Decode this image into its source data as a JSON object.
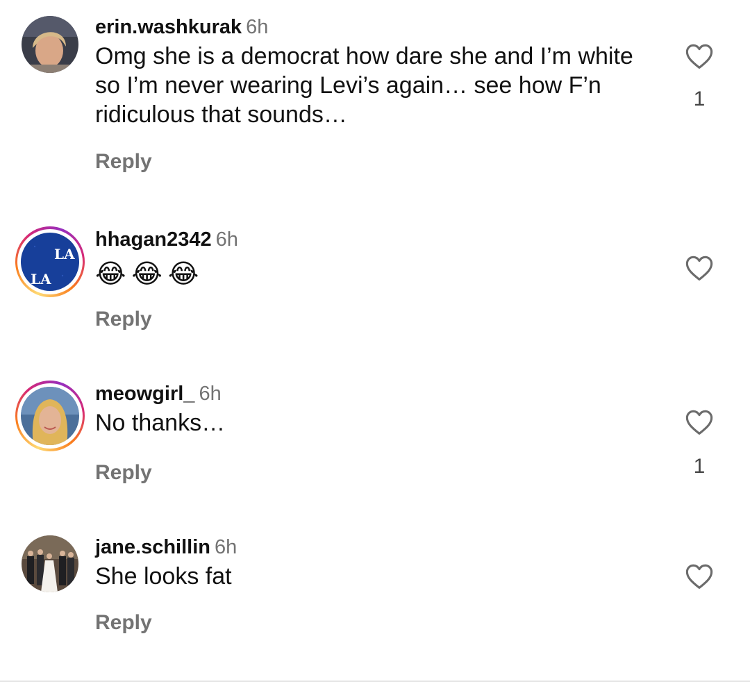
{
  "comments": [
    {
      "username": "erin.washkurak",
      "time": "6h",
      "text": "Omg she is a democrat how dare she and I’m white so I’m never wearing Levi’s again… see how F’n ridiculous that sounds…",
      "reply_label": "Reply",
      "likes": "1",
      "has_story_ring": false
    },
    {
      "username": "hhagan2342",
      "time": "6h",
      "text": "",
      "emoji": [
        "😂",
        "😂",
        "😂"
      ],
      "reply_label": "Reply",
      "likes": "",
      "has_story_ring": true
    },
    {
      "username": "meowgirl_",
      "time": "6h",
      "text": "No thanks…",
      "reply_label": "Reply",
      "likes": "1",
      "has_story_ring": true
    },
    {
      "username": "jane.schillin",
      "time": "6h",
      "text": "She looks fat",
      "reply_label": "Reply",
      "likes": "",
      "has_story_ring": false
    }
  ],
  "icons": {
    "like": "heart-outline-icon"
  },
  "colors": {
    "secondary_text": "#737373",
    "story_ring_start": "#feda75",
    "story_ring_end": "#d62976"
  }
}
